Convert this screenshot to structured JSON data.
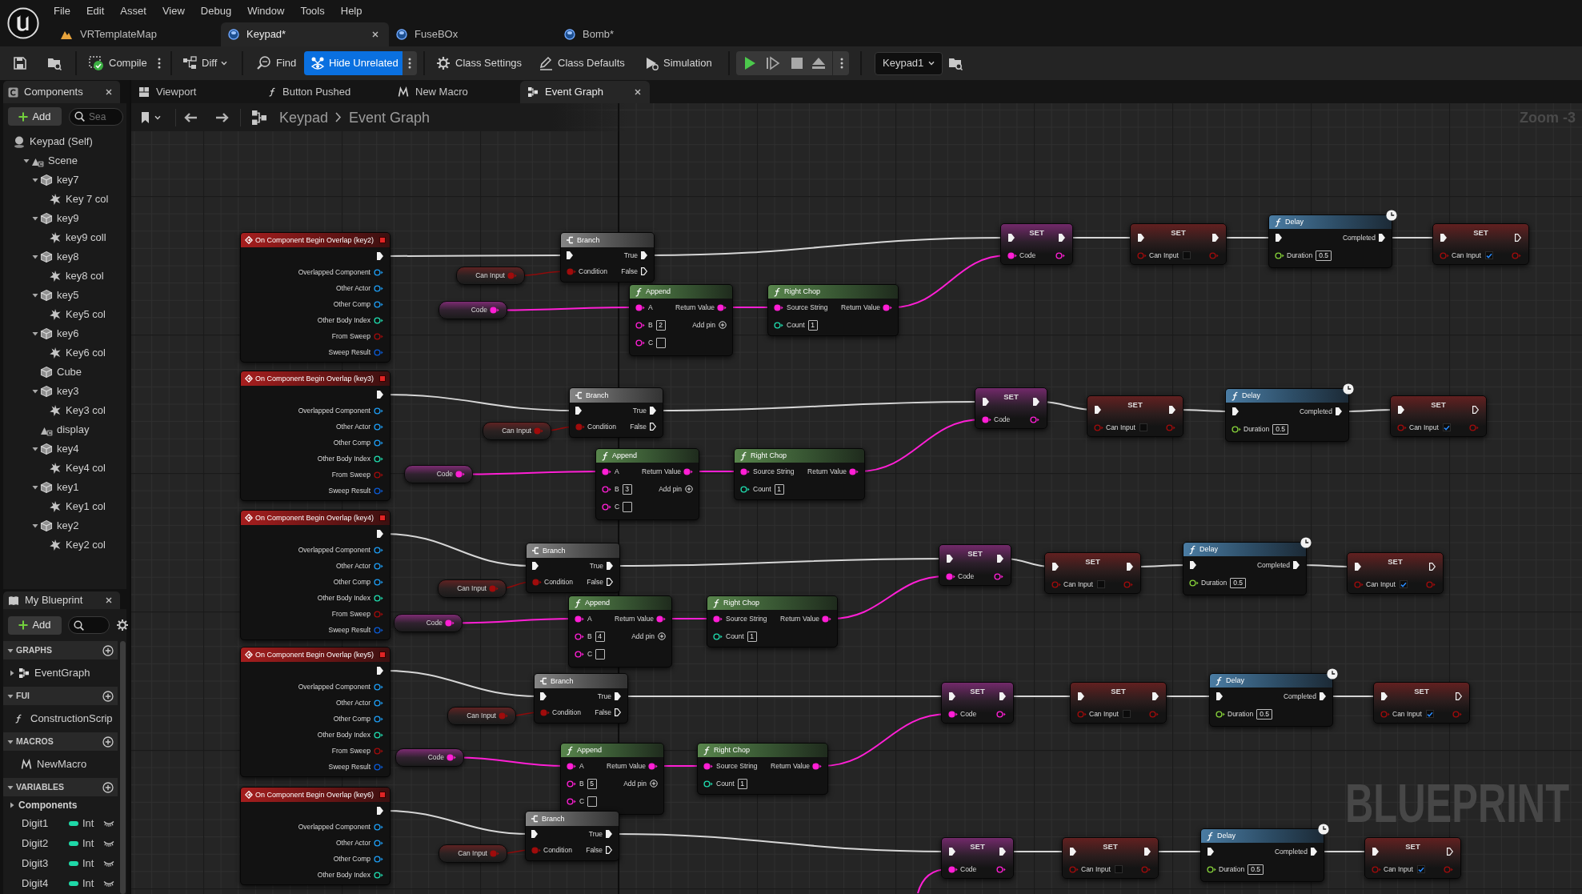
{
  "menu": [
    "File",
    "Edit",
    "Asset",
    "View",
    "Debug",
    "Window",
    "Tools",
    "Help"
  ],
  "document_tabs": [
    {
      "label": "VRTemplateMap",
      "kind": "level",
      "selected": false
    },
    {
      "label": "Keypad*",
      "kind": "blueprint",
      "selected": true
    },
    {
      "label": "FuseBOx",
      "kind": "blueprint",
      "selected": false
    },
    {
      "label": "Bomb*",
      "kind": "blueprint",
      "selected": false
    }
  ],
  "toolbar": {
    "compile": "Compile",
    "diff": "Diff",
    "find": "Find",
    "hide_unrelated": {
      "label": "Hide Unrelated",
      "on": true
    },
    "class_settings": "Class Settings",
    "class_defaults": "Class Defaults",
    "simulation": "Simulation",
    "debug_object": "Keypad1"
  },
  "components_panel": {
    "title": "Components",
    "add": "Add",
    "search": {
      "placeholder": "Sea"
    },
    "tree": [
      {
        "label": "Keypad (Self)",
        "kind": "self",
        "children": [
          {
            "label": "Scene",
            "kind": "scene",
            "expanded": true,
            "children": [
              {
                "label": "key7",
                "kind": "mesh",
                "expanded": true,
                "children": [
                  {
                    "label": "Key 7 col",
                    "kind": "collision"
                  }
                ]
              },
              {
                "label": "key9",
                "kind": "mesh",
                "expanded": true,
                "children": [
                  {
                    "label": "key9 coll",
                    "kind": "collision"
                  }
                ]
              },
              {
                "label": "key8",
                "kind": "mesh",
                "expanded": true,
                "children": [
                  {
                    "label": "key8 col",
                    "kind": "collision"
                  }
                ]
              },
              {
                "label": "key5",
                "kind": "mesh",
                "expanded": true,
                "children": [
                  {
                    "label": "Key5 col",
                    "kind": "collision"
                  }
                ]
              },
              {
                "label": "key6",
                "kind": "mesh",
                "expanded": true,
                "children": [
                  {
                    "label": "Key6 col",
                    "kind": "collision"
                  }
                ]
              },
              {
                "label": "Cube",
                "kind": "mesh"
              },
              {
                "label": "key3",
                "kind": "mesh",
                "expanded": true,
                "children": [
                  {
                    "label": "Key3 col",
                    "kind": "collision"
                  }
                ]
              },
              {
                "label": "display",
                "kind": "scene"
              },
              {
                "label": "key4",
                "kind": "mesh",
                "expanded": true,
                "children": [
                  {
                    "label": "Key4 col",
                    "kind": "collision"
                  }
                ]
              },
              {
                "label": "key1",
                "kind": "mesh",
                "expanded": true,
                "children": [
                  {
                    "label": "Key1 col",
                    "kind": "collision"
                  }
                ]
              },
              {
                "label": "key2",
                "kind": "mesh",
                "expanded": true,
                "children": [
                  {
                    "label": "Key2 col",
                    "kind": "collision"
                  }
                ]
              }
            ]
          }
        ]
      }
    ]
  },
  "my_blueprint": {
    "title": "My Blueprint",
    "add": "Add",
    "sections": [
      {
        "title": "GRAPHS",
        "expanded": true,
        "items": [
          {
            "label": "EventGraph",
            "kind": "graph",
            "expanded": false
          }
        ]
      },
      {
        "title": "FUI",
        "expanded": true,
        "items": [
          {
            "label": "ConstructionScrip",
            "kind": "function"
          }
        ]
      },
      {
        "title": "MACROS",
        "expanded": true,
        "items": [
          {
            "label": "NewMacro",
            "kind": "macro"
          }
        ]
      },
      {
        "title": "VARIABLES",
        "expanded": true,
        "items": [
          {
            "label": "Components",
            "kind": "category",
            "expanded": false
          },
          {
            "label": "Digit1",
            "kind": "variable",
            "type": "Int"
          },
          {
            "label": "Digit2",
            "kind": "variable",
            "type": "Int"
          },
          {
            "label": "Digit3",
            "kind": "variable",
            "type": "Int"
          },
          {
            "label": "Digit4",
            "kind": "variable",
            "type": "Int"
          }
        ]
      }
    ]
  },
  "editor_tabs": [
    {
      "label": "Viewport",
      "kind": "viewport",
      "selected": false
    },
    {
      "label": "Button Pushed",
      "kind": "function",
      "selected": false
    },
    {
      "label": "New Macro",
      "kind": "macro",
      "selected": false
    },
    {
      "label": "Event Graph",
      "kind": "graph",
      "selected": true
    }
  ],
  "graph": {
    "breadcrumb": [
      "Keypad",
      "Event Graph"
    ],
    "zoom": "Zoom -3",
    "watermark": "BLUEPRINT",
    "sequences": [
      {
        "event": {
          "title": "On Component Begin Overlap (key2)",
          "pins": [
            {
              "label": "Overlapped Component",
              "kind": "object"
            },
            {
              "label": "Other Actor",
              "kind": "object"
            },
            {
              "label": "Other Comp",
              "kind": "object"
            },
            {
              "label": "Other Body Index",
              "kind": "int"
            },
            {
              "label": "From Sweep",
              "kind": "bool"
            },
            {
              "label": "Sweep Result",
              "kind": "struct"
            }
          ]
        },
        "can_input": "Can Input",
        "code": "Code",
        "branch": {
          "title": "Branch",
          "condition": "Condition",
          "true_label": "True",
          "false_label": "False"
        },
        "append": {
          "title": "Append",
          "a": "A",
          "b": "B",
          "b_value": "2",
          "c": "C",
          "return_label": "Return Value",
          "add_pin": "Add pin"
        },
        "right_chop": {
          "title": "Right Chop",
          "source": "Source String",
          "count": "Count",
          "count_value": "1",
          "return_label": "Return Value"
        },
        "set_code": {
          "title": "SET",
          "pin": "Code"
        },
        "set_disable": {
          "title": "SET",
          "pin": "Can Input",
          "checked": false
        },
        "delay": {
          "title": "Delay",
          "completed": "Completed",
          "duration": "Duration",
          "duration_value": "0.5"
        },
        "set_enable": {
          "title": "SET",
          "pin": "Can Input",
          "checked": true
        }
      },
      {
        "event": {
          "title": "On Component Begin Overlap (key3)",
          "pins": [
            {
              "label": "Overlapped Component",
              "kind": "object"
            },
            {
              "label": "Other Actor",
              "kind": "object"
            },
            {
              "label": "Other Comp",
              "kind": "object"
            },
            {
              "label": "Other Body Index",
              "kind": "int"
            },
            {
              "label": "From Sweep",
              "kind": "bool"
            },
            {
              "label": "Sweep Result",
              "kind": "struct"
            }
          ]
        },
        "can_input": "Can Input",
        "code": "Code",
        "branch": {
          "title": "Branch",
          "condition": "Condition",
          "true_label": "True",
          "false_label": "False"
        },
        "append": {
          "title": "Append",
          "a": "A",
          "b": "B",
          "b_value": "3",
          "c": "C",
          "return_label": "Return Value",
          "add_pin": "Add pin"
        },
        "right_chop": {
          "title": "Right Chop",
          "source": "Source String",
          "count": "Count",
          "count_value": "1",
          "return_label": "Return Value"
        },
        "set_code": {
          "title": "SET",
          "pin": "Code"
        },
        "set_disable": {
          "title": "SET",
          "pin": "Can Input",
          "checked": false
        },
        "delay": {
          "title": "Delay",
          "completed": "Completed",
          "duration": "Duration",
          "duration_value": "0.5"
        },
        "set_enable": {
          "title": "SET",
          "pin": "Can Input",
          "checked": true
        }
      },
      {
        "event": {
          "title": "On Component Begin Overlap (key4)",
          "pins": [
            {
              "label": "Overlapped Component",
              "kind": "object"
            },
            {
              "label": "Other Actor",
              "kind": "object"
            },
            {
              "label": "Other Comp",
              "kind": "object"
            },
            {
              "label": "Other Body Index",
              "kind": "int"
            },
            {
              "label": "From Sweep",
              "kind": "bool"
            },
            {
              "label": "Sweep Result",
              "kind": "struct"
            }
          ]
        },
        "can_input": "Can Input",
        "code": "Code",
        "branch": {
          "title": "Branch",
          "condition": "Condition",
          "true_label": "True",
          "false_label": "False"
        },
        "append": {
          "title": "Append",
          "a": "A",
          "b": "B",
          "b_value": "4",
          "c": "C",
          "return_label": "Return Value",
          "add_pin": "Add pin"
        },
        "right_chop": {
          "title": "Right Chop",
          "source": "Source String",
          "count": "Count",
          "count_value": "1",
          "return_label": "Return Value"
        },
        "set_code": {
          "title": "SET",
          "pin": "Code"
        },
        "set_disable": {
          "title": "SET",
          "pin": "Can Input",
          "checked": false
        },
        "delay": {
          "title": "Delay",
          "completed": "Completed",
          "duration": "Duration",
          "duration_value": "0.5"
        },
        "set_enable": {
          "title": "SET",
          "pin": "Can Input",
          "checked": true
        }
      },
      {
        "event": {
          "title": "On Component Begin Overlap (key5)",
          "pins": [
            {
              "label": "Overlapped Component",
              "kind": "object"
            },
            {
              "label": "Other Actor",
              "kind": "object"
            },
            {
              "label": "Other Comp",
              "kind": "object"
            },
            {
              "label": "Other Body Index",
              "kind": "int"
            },
            {
              "label": "From Sweep",
              "kind": "bool"
            },
            {
              "label": "Sweep Result",
              "kind": "struct"
            }
          ]
        },
        "can_input": "Can Input",
        "code": "Code",
        "branch": {
          "title": "Branch",
          "condition": "Condition",
          "true_label": "True",
          "false_label": "False"
        },
        "append": {
          "title": "Append",
          "a": "A",
          "b": "B",
          "b_value": "5",
          "c": "C",
          "return_label": "Return Value",
          "add_pin": "Add pin"
        },
        "right_chop": {
          "title": "Right Chop",
          "source": "Source String",
          "count": "Count",
          "count_value": "1",
          "return_label": "Return Value"
        },
        "set_code": {
          "title": "SET",
          "pin": "Code"
        },
        "set_disable": {
          "title": "SET",
          "pin": "Can Input",
          "checked": false
        },
        "delay": {
          "title": "Delay",
          "completed": "Completed",
          "duration": "Duration",
          "duration_value": "0.5"
        },
        "set_enable": {
          "title": "SET",
          "pin": "Can Input",
          "checked": true
        }
      },
      {
        "event": {
          "title": "On Component Begin Overlap (key6)",
          "pins": [
            {
              "label": "Overlapped Component",
              "kind": "object"
            },
            {
              "label": "Other Actor",
              "kind": "object"
            },
            {
              "label": "Other Comp",
              "kind": "object"
            },
            {
              "label": "Other Body Index",
              "kind": "int"
            }
          ]
        },
        "can_input": "Can Input",
        "branch": {
          "title": "Branch",
          "condition": "Condition",
          "true_label": "True",
          "false_label": "False"
        },
        "set_code": {
          "title": "SET",
          "pin": "Code"
        },
        "set_disable": {
          "title": "SET",
          "pin": "Can Input",
          "checked": false
        },
        "delay": {
          "title": "Delay",
          "completed": "Completed",
          "duration": "Duration",
          "duration_value": "0.5"
        },
        "set_enable": {
          "title": "SET",
          "pin": "Can Input",
          "checked": true
        }
      }
    ]
  }
}
